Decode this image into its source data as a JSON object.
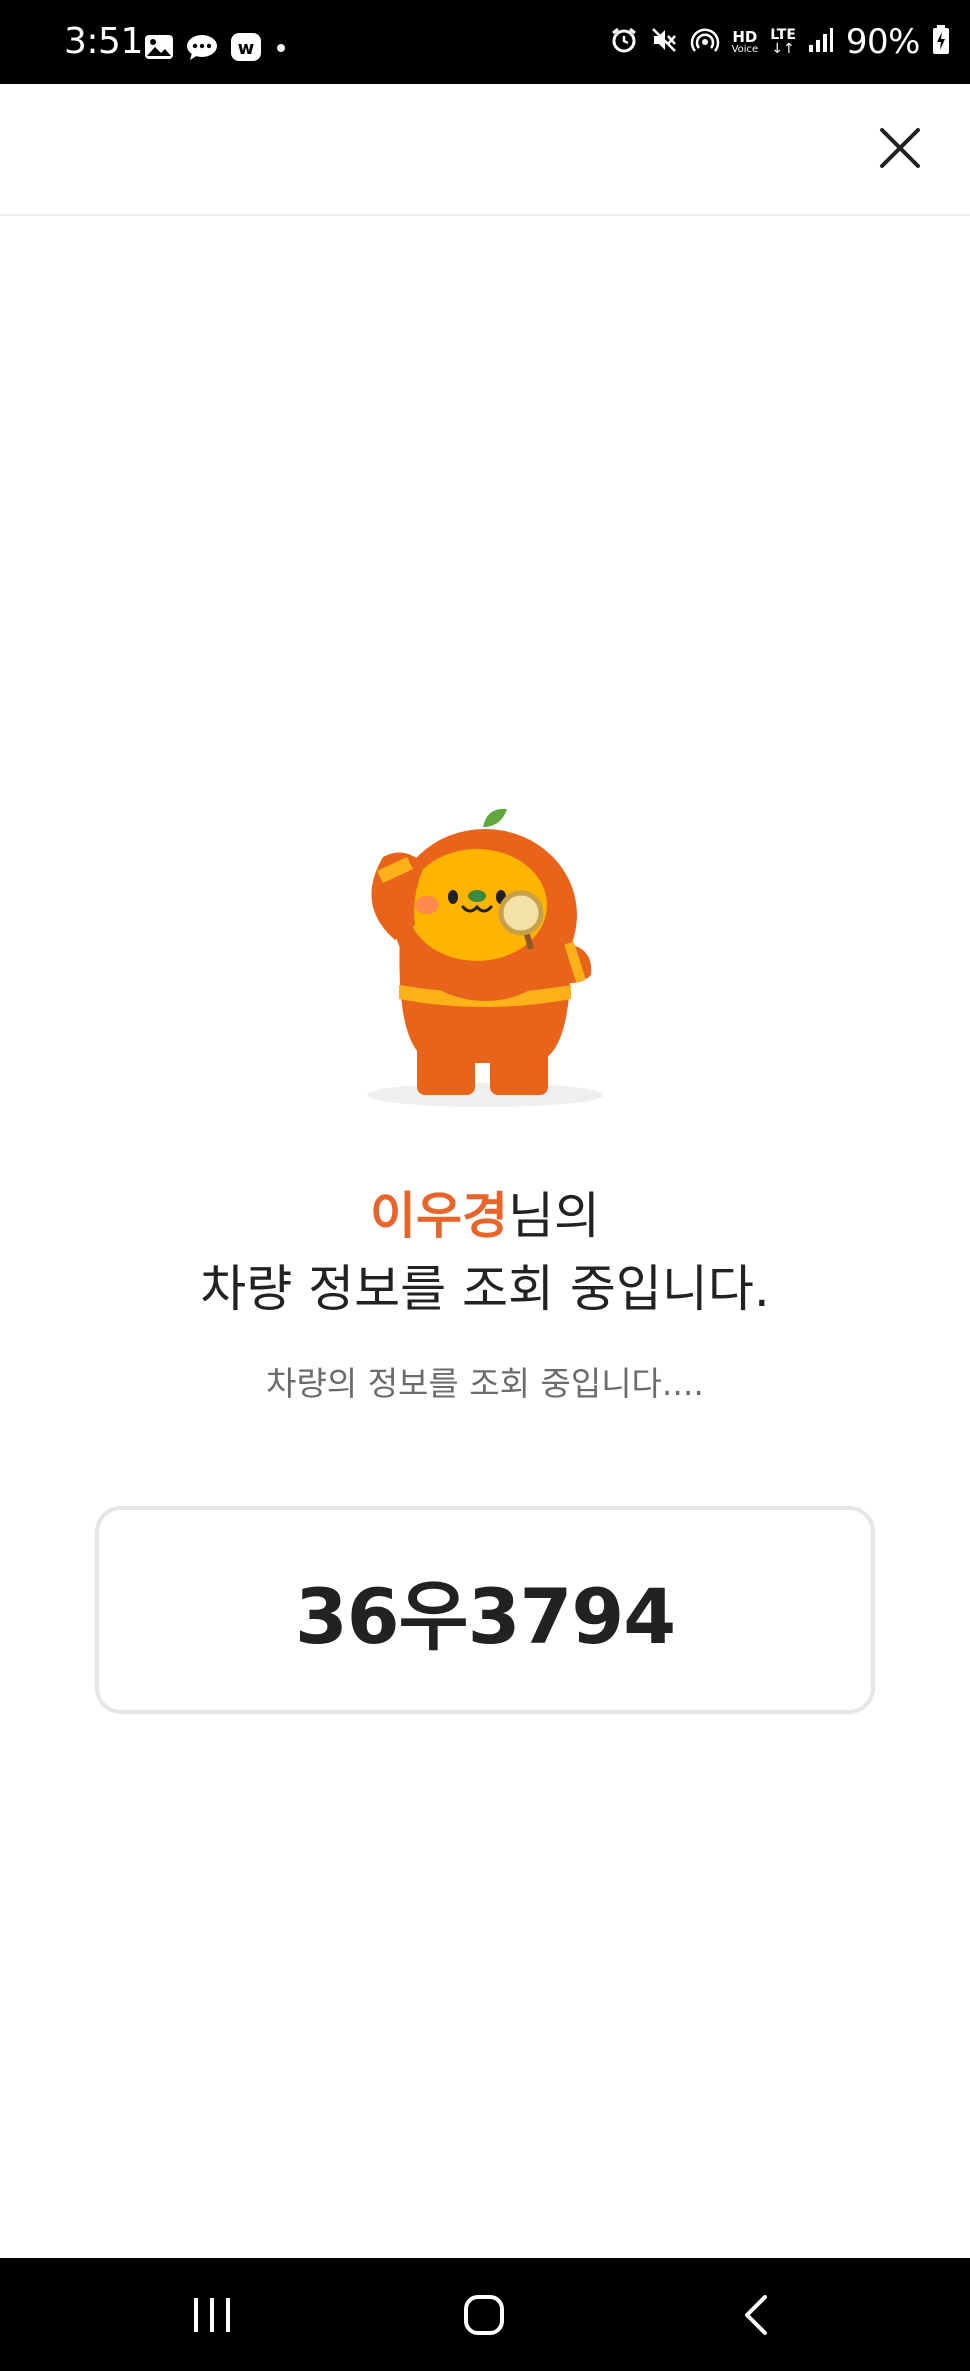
{
  "status_bar": {
    "time": "3:51",
    "battery_percent": "90%",
    "hd_label": "HD",
    "voice_label": "Voice",
    "lte_label": "LTE",
    "lte_arrows": "↓↑",
    "left_icons": [
      "gallery-icon",
      "chat-bubble-icon",
      "w-app-icon",
      "dot-icon"
    ],
    "right_icons": [
      "alarm-icon",
      "mute-icon",
      "hotspot-icon",
      "hd-voice-icon",
      "lte-icon",
      "signal-icon",
      "battery-charging-icon"
    ]
  },
  "header": {
    "close_icon": "close-icon"
  },
  "main": {
    "user_name": "이우경",
    "name_suffix": "님의",
    "title_line2": "차량 정보를 조회 중입니다.",
    "subtitle": "차량의 정보를 조회 중입니다....",
    "plate_number": "36우3794"
  },
  "colors": {
    "accent": "#e8642a",
    "text": "#222222",
    "subtext": "#6b6b6b",
    "border": "#e6e6e6"
  },
  "nav_bar": {
    "buttons": [
      "recents-icon",
      "home-icon",
      "back-icon"
    ]
  }
}
